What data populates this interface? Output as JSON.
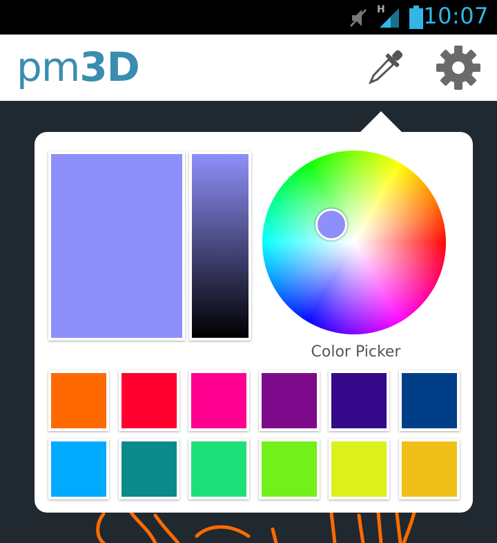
{
  "status_bar": {
    "time": "10:07",
    "network_type": "H",
    "icons": [
      "mute-icon",
      "signal-icon",
      "battery-icon"
    ]
  },
  "app_bar": {
    "logo_light": "pm",
    "logo_bold": "3D",
    "actions": [
      "eyedropper-icon",
      "settings-gear-icon"
    ]
  },
  "color_picker": {
    "title": "Color Picker",
    "selected_color": "#8f8ffb",
    "swatches": [
      "#ff6a00",
      "#ff0030",
      "#ff0090",
      "#7d0a8a",
      "#340a8a",
      "#003f88",
      "#00aaff",
      "#0a8a8a",
      "#1ee07a",
      "#72f01a",
      "#dcf01a",
      "#f0c01a"
    ]
  },
  "colors": {
    "accent": "#3b8db0",
    "clock": "#33b5e5",
    "background": "#202830",
    "sketch_stroke": "#ff6a00"
  }
}
